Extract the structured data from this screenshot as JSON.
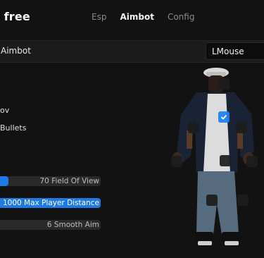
{
  "app": {
    "title": "t free"
  },
  "tabs": [
    {
      "label": "Esp",
      "active": false
    },
    {
      "label": "Aimbot",
      "active": true
    },
    {
      "label": "Config",
      "active": false
    }
  ],
  "aimbot_row": {
    "label": "Aimbot",
    "key_value": "LMouse"
  },
  "options": [
    {
      "label": "ov"
    },
    {
      "label": "Bullets"
    }
  ],
  "sliders": [
    {
      "label": "70 Field Of View",
      "fill_fraction": 0.12
    },
    {
      "label": "1000 Max Player Distance",
      "fill_fraction": 1.0
    },
    {
      "label": "6 Smooth Aim",
      "fill_fraction": 0.02
    }
  ],
  "colors": {
    "accent": "#1e7ae6",
    "background": "#121212"
  },
  "hitboxes": [
    {
      "part": "head",
      "selected": false
    },
    {
      "part": "chest",
      "selected": true
    },
    {
      "part": "left-arm",
      "selected": false
    },
    {
      "part": "right-arm",
      "selected": false
    },
    {
      "part": "left-hand",
      "selected": false
    },
    {
      "part": "stomach",
      "selected": false
    },
    {
      "part": "right-hand",
      "selected": false
    },
    {
      "part": "left-leg",
      "selected": false
    },
    {
      "part": "right-leg",
      "selected": false
    }
  ]
}
